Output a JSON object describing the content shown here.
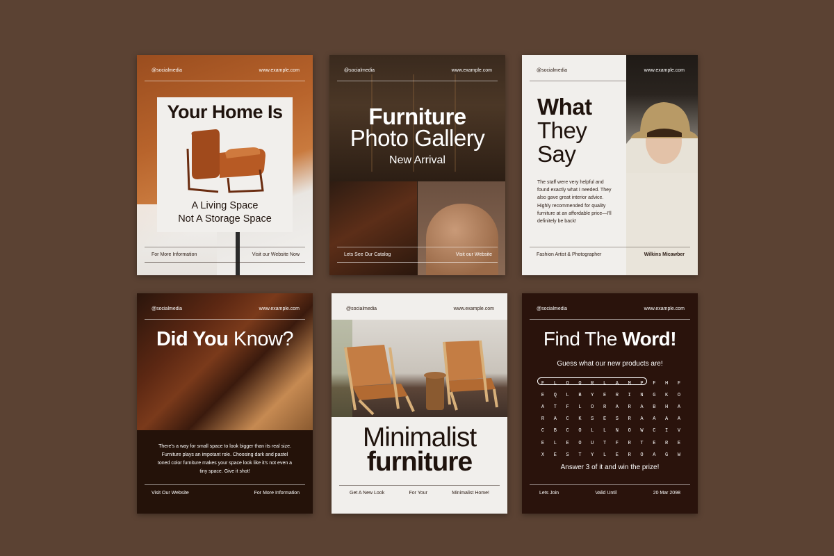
{
  "card1": {
    "handle": "@socialmedia",
    "website": "www.example.com",
    "headline": "Your Home Is",
    "sub_line1": "A Living Space",
    "sub_line2": "Not A Storage Space",
    "footer_left": "For More Information",
    "footer_right": "Visit our Website Now"
  },
  "card2": {
    "handle": "@socialmedia",
    "website": "www.example.com",
    "title_line1": "Furniture",
    "title_line2": "Photo Gallery",
    "title_line3": "New Arrival",
    "footer_left": "Lets See Our Catalog",
    "footer_right": "Visit our Website"
  },
  "card3": {
    "handle": "@socialmedia",
    "website": "www.example.com",
    "title_line1": "What",
    "title_line2": "They",
    "title_line3": "Say",
    "quote": "The staff were very helpful and found exactly what I needed. They also gave great interior advice. Highly recommended for quality furniture at an affordable price—I'll definitely be back!",
    "footer_left": "Fashion Artist & Photographer",
    "footer_right": "Wilkins Micawber"
  },
  "card4": {
    "handle": "@socialmedia",
    "website": "www.example.com",
    "title_bold": "Did You",
    "title_regular": " Know?",
    "paragraph": "There's a way for small space to look bigger than its real size. Furniture plays an impotant role. Choosing dark and pastel toned color furniture makes your space look like it's not even a tiny space. Give it shot!",
    "footer_left": "Visit Our Website",
    "footer_right": "For More Information"
  },
  "card5": {
    "handle": "@socialmedia",
    "website": "www.example.com",
    "title_line1": "Minimalist",
    "title_line2": "furniture",
    "footer_left": "Get A New Look",
    "footer_center": "For Your",
    "footer_right": "Minimalist Home!"
  },
  "card6": {
    "handle": "@socialmedia",
    "website": "www.example.com",
    "title_regular": "Find The ",
    "title_bold": "Word!",
    "guess": "Guess what our new products are!",
    "grid": [
      [
        "F",
        "L",
        "O",
        "O",
        "R",
        "L",
        "A",
        "M",
        "P",
        "F",
        "H",
        "F"
      ],
      [
        "E",
        "Q",
        "L",
        "B",
        "Y",
        "E",
        "R",
        "I",
        "N",
        "G",
        "K",
        "O"
      ],
      [
        "A",
        "T",
        "F",
        "L",
        "O",
        "R",
        "A",
        "R",
        "A",
        "B",
        "H",
        "A"
      ],
      [
        "R",
        "A",
        "C",
        "K",
        "S",
        "E",
        "S",
        "R",
        "A",
        "A",
        "A",
        "A"
      ],
      [
        "C",
        "B",
        "C",
        "O",
        "L",
        "L",
        "N",
        "O",
        "W",
        "C",
        "I",
        "V"
      ],
      [
        "E",
        "L",
        "E",
        "O",
        "U",
        "T",
        "F",
        "R",
        "T",
        "E",
        "R",
        "E"
      ],
      [
        "X",
        "E",
        "S",
        "T",
        "Y",
        "L",
        "E",
        "R",
        "O",
        "A",
        "G",
        "W"
      ]
    ],
    "answer": "Answer 3 of it and win the prize!",
    "footer_left": "Lets Join",
    "footer_center": "Valid Until",
    "footer_right": "20 Mar 2098"
  }
}
